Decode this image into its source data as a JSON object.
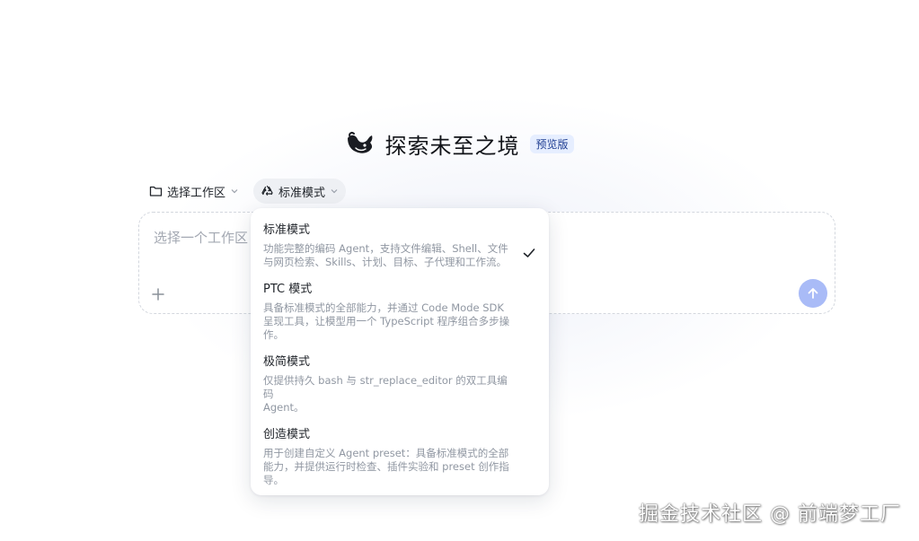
{
  "header": {
    "title": "探索未至之境",
    "badge": "预览版",
    "logo_icon": "whale-logo-icon"
  },
  "toolbar": {
    "workspace_label": "选择工作区",
    "mode_label": "标准模式"
  },
  "input": {
    "placeholder": "选择一个工作区"
  },
  "dropdown": {
    "items": [
      {
        "name": "标准模式",
        "desc_lines": [
          "功能完整的编码 Agent，支持文件编辑、Shell、文件",
          "与网页检索、Skills、计划、目标、子代理和工作流。"
        ],
        "selected": true
      },
      {
        "name": "PTC 模式",
        "desc_lines": [
          "具备标准模式的全部能力，并通过 Code Mode SDK",
          "呈现工具，让模型用一个 TypeScript 程序组合多步操",
          "作。"
        ],
        "selected": false
      },
      {
        "name": "极简模式",
        "desc_lines": [
          "仅提供持久 bash 与 str_replace_editor 的双工具编码",
          "Agent。"
        ],
        "selected": false
      },
      {
        "name": "创造模式",
        "desc_lines": [
          "用于创建自定义 Agent preset：具备标准模式的全部",
          "能力，并提供运行时检查、插件实验和 preset 创作指",
          "导。"
        ],
        "selected": false
      }
    ]
  },
  "watermark": "掘金技术社区 @ 前端梦工厂",
  "colors": {
    "accent": "#a9bbf7",
    "badge_bg": "#e6eeff",
    "badge_text": "#1d3c91"
  }
}
